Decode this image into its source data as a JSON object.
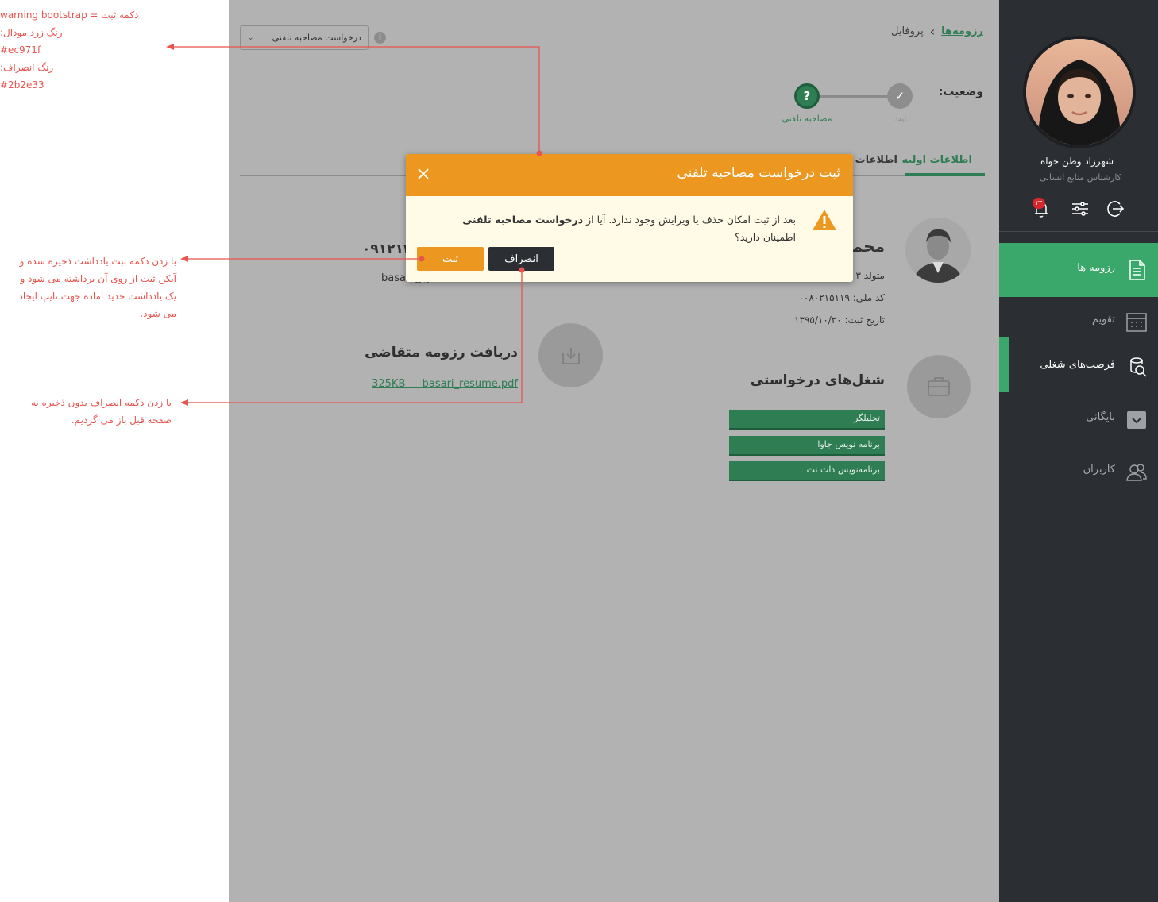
{
  "annotations": {
    "top": {
      "line1": "warning bootstrap = دکمه ثبت",
      "line2": "رنگ زرد مودال:",
      "line3": "#ec971f",
      "line4": "رنگ انصراف:",
      "line5": "#2b2e33"
    },
    "confirm_note": "با زدن دکمه ثبت یادداشت ذخیره شده و آیکن ثبت از روی آن برداشته می شود و یک یادداشت جدید آماده جهت تایپ ایجاد می شود.",
    "cancel_note": "با زدن دکمه انصراف بدون ذخیره به صفحه قبل باز می گردیم."
  },
  "breadcrumb": {
    "link": "رزومه‌ها",
    "current": "پروفایل"
  },
  "request_select": {
    "value": "درخواست مصاحبه تلفنی"
  },
  "status": {
    "label": "وضعیت:",
    "steps": [
      {
        "label": "ثبت"
      },
      {
        "label": "مصاحبه تلفنی",
        "marker": "?"
      }
    ]
  },
  "tabs": [
    {
      "label": "اطلاعات اولیه"
    },
    {
      "label": "اطلاعات تماس"
    }
  ],
  "person": {
    "name": "محمد",
    "born": "متولد ۳",
    "national_id": "کد ملی: ۰۰۸۰۲۱۵۱۱۹",
    "reg_date": "تاریخ ثبت: ۱۳۹۵/۱۰/۲۰",
    "phone": "۰۹۱۲۱۳۰",
    "email": "basari@gmail.com"
  },
  "resume": {
    "title": "دریافت رزومه متقاضی",
    "file": "325KB — basari_resume.pdf"
  },
  "jobs": {
    "title": "شغل‌های درخواستی",
    "items": [
      "تحلیلگر",
      "برنامه نویس جاوا",
      "برنامه‌نویس دات نت"
    ]
  },
  "modal": {
    "title": "ثبت درخواست مصاحبه تلفنی",
    "text_before": "بعد از ثبت امکان حذف یا ویرایش وجود ندارد. آیا از ",
    "text_bold": "درخواست مصاحبه تلفنی",
    "text_after": " اطمینان دارید؟",
    "confirm": "ثبت",
    "cancel": "انصراف"
  },
  "sidebar": {
    "user_name": "شهرزاد  وطن خواه",
    "user_role": "کارشناس منابع انسانی",
    "notif_count": "۲۳",
    "items": [
      {
        "label": "رزومه ها"
      },
      {
        "label": "تقویم"
      },
      {
        "label": "فرصت‌های شغلی"
      },
      {
        "label": "بایگانی"
      },
      {
        "label": "کاربران"
      }
    ]
  },
  "colors": {
    "modal_warning": "#ec971f",
    "cancel_button": "#2b2e33",
    "accent_green": "#3aa86b",
    "annotation_red": "#e8544e"
  }
}
